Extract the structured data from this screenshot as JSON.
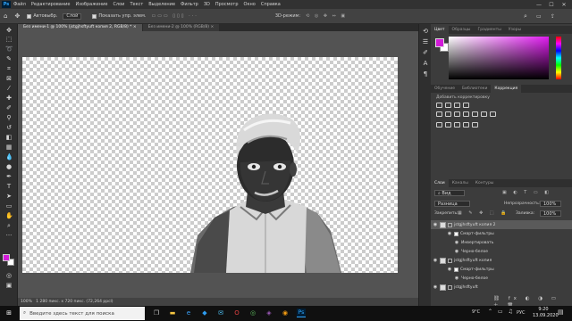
{
  "app": {
    "logo": "Ps"
  },
  "menu": [
    "Файл",
    "Редактирование",
    "Изображение",
    "Слои",
    "Текст",
    "Выделение",
    "Фильтр",
    "3D",
    "Просмотр",
    "Окно",
    "Справка"
  ],
  "window_controls": {
    "minimize": "—",
    "maximize": "☐",
    "close": "✕"
  },
  "options": {
    "autoselect_label": "Автовыбр.",
    "layer_select": "Слой",
    "transform_label": "Показать упр. элем.",
    "three_d_label": "3D-режим:"
  },
  "tabs": [
    {
      "label": "Без имени-1 @ 100% (jstgjhsftyuft копия 2, RGB/8) *",
      "close": "×"
    },
    {
      "label": "Без имени-2 @ 100% (RGB/8)",
      "close": "×"
    }
  ],
  "status": {
    "zoom": "100%",
    "doc_size": "1 280 пикс. x 720 пикс. (72,264 ppcl)"
  },
  "color_panel": {
    "tabs": [
      "Цвет",
      "Образцы",
      "Градиенты",
      "Узоры"
    ],
    "foreground": "#d21bd8",
    "background": "#ffffff",
    "hue_color": "#e01cf0"
  },
  "adjust_panel": {
    "tabs": [
      "Обучение",
      "Библиотеки",
      "Коррекция"
    ],
    "subtitle": "Добавить корректировку"
  },
  "layers_panel": {
    "tabs": [
      "Слои",
      "Каналы",
      "Контуры"
    ],
    "kind_label": "Вид",
    "blend_mode": "Разница",
    "opacity_label": "Непрозрачность:",
    "opacity": "100%",
    "lock_label": "Закрепить:",
    "fill_label": "Заливка:",
    "fill": "100%",
    "layers": [
      {
        "name": "jstgjhsftyuft копия 2",
        "type": "layer",
        "selected": true
      },
      {
        "name": "Смарт-фильтры",
        "type": "sub"
      },
      {
        "name": "Инвертировать",
        "type": "sub2"
      },
      {
        "name": "Черно-белое",
        "type": "sub2"
      },
      {
        "name": "jstgjhsftyuft копия",
        "type": "layer"
      },
      {
        "name": "Смарт-фильтры",
        "type": "sub"
      },
      {
        "name": "Черно-белое",
        "type": "sub2"
      },
      {
        "name": "jstgjhsftyuft",
        "type": "layer"
      }
    ]
  },
  "taskbar": {
    "search_placeholder": "Введите здесь текст для поиска",
    "temp": "9°C",
    "lang": "РУС",
    "time": "9:20",
    "date": "13.09.2020"
  }
}
